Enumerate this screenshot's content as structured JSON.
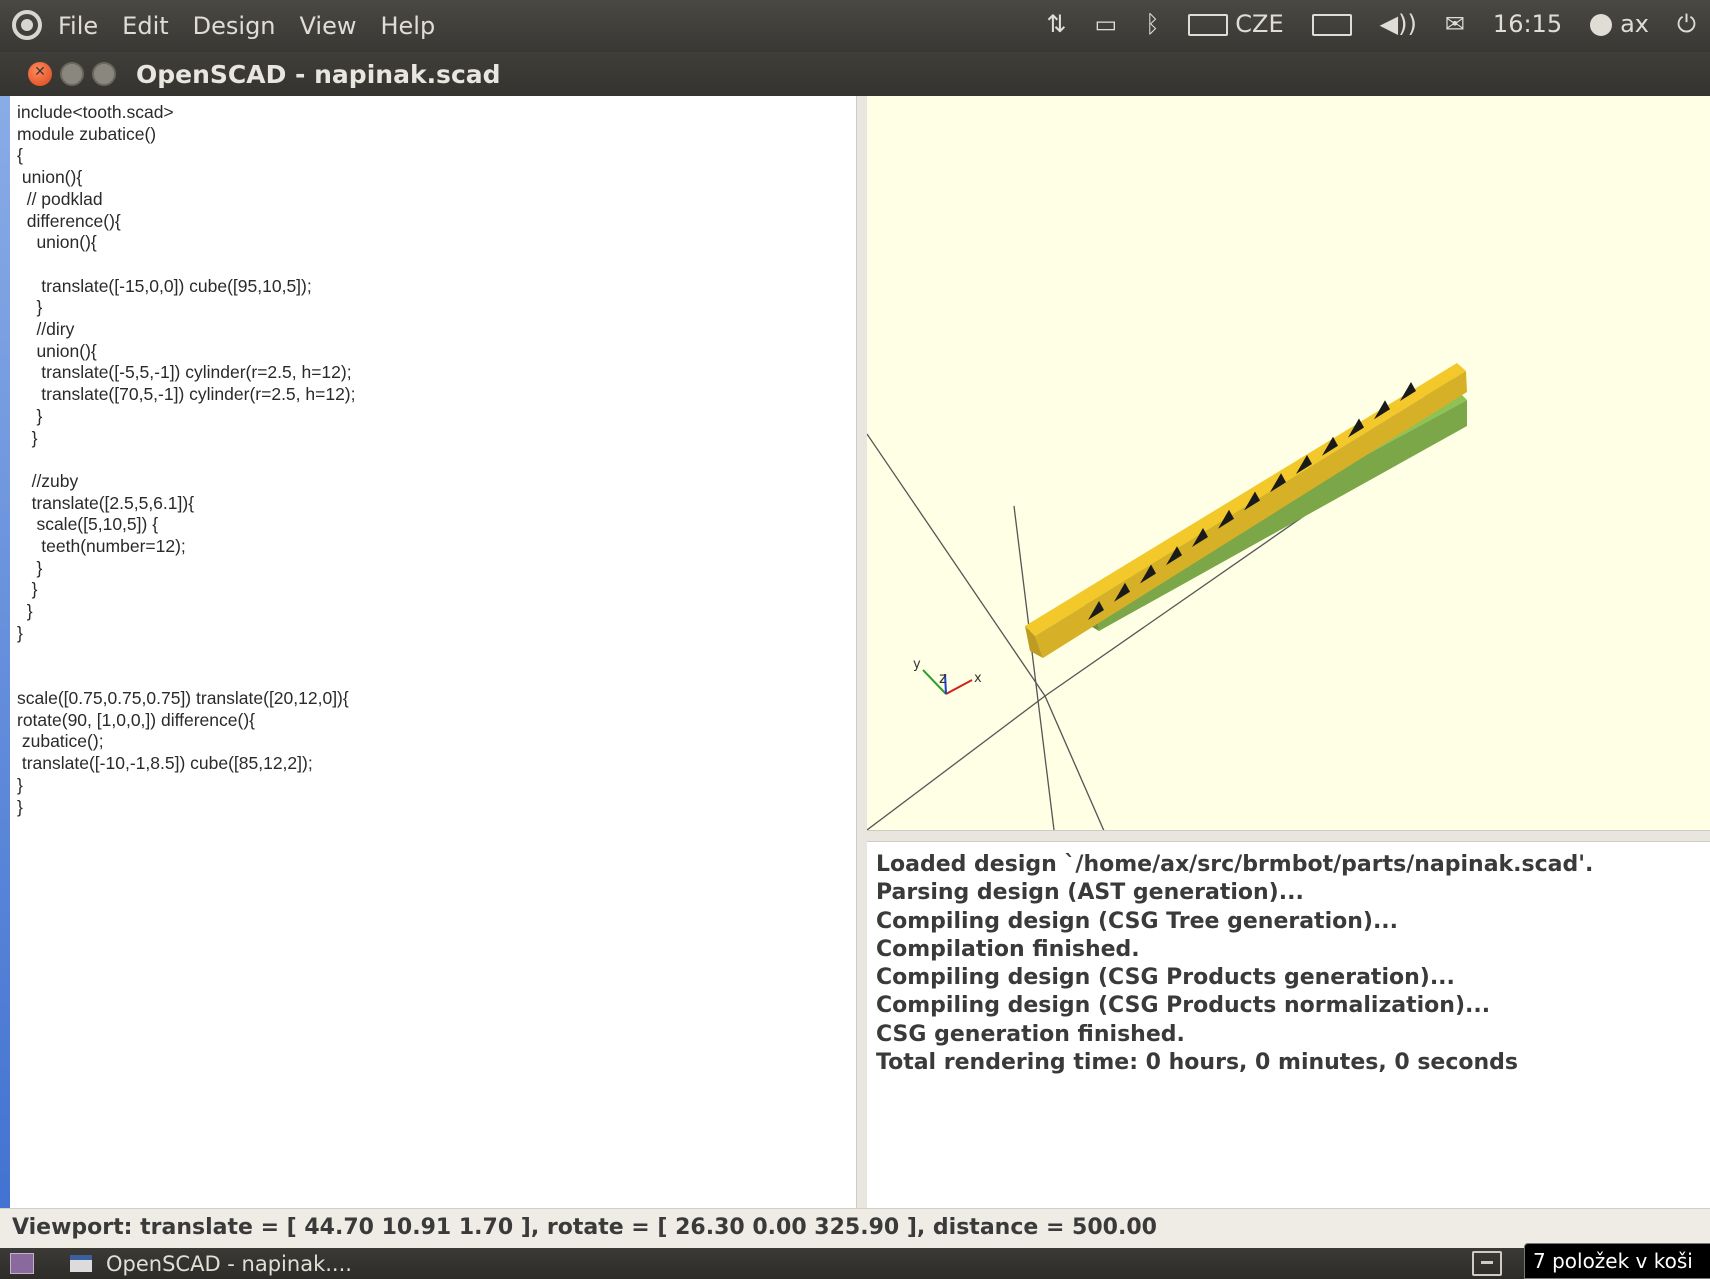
{
  "top_panel": {
    "menu": [
      "File",
      "Edit",
      "Design",
      "View",
      "Help"
    ],
    "indicators": {
      "network_icon": "network-arrows-icon",
      "display_icon": "monitor-icon",
      "bluetooth_icon": "bluetooth-icon",
      "keyboard_label": "CZE",
      "battery_icon": "battery-icon",
      "volume_icon": "speaker-icon",
      "mail_icon": "envelope-icon",
      "time": "16:15",
      "user": "ax",
      "power_icon": "power-icon"
    }
  },
  "window": {
    "title": "OpenSCAD - napinak.scad"
  },
  "editor": {
    "lines": [
      "include<tooth.scad>",
      "module zubatice()",
      "{",
      " union(){",
      "  // podklad",
      "  difference(){",
      "    union(){",
      "",
      "     translate([-15,0,0]) cube([95,10,5]);",
      "    }",
      "    //diry",
      "    union(){",
      "     translate([-5,5,-1]) cylinder(r=2.5, h=12);",
      "     translate([70,5,-1]) cylinder(r=2.5, h=12);",
      "    }",
      "   }",
      "",
      "   //zuby",
      "   translate([2.5,5,6.1]){",
      "    scale([5,10,5]) {",
      "     teeth(number=12);",
      "    }",
      "   }",
      "  }",
      "}",
      "",
      "",
      "scale([0.75,0.75,0.75]) translate([20,12,0]){",
      "rotate(90, [1,0,0,]) difference(){",
      " zubatice();",
      " translate([-10,-1,8.5]) cube([85,12,2]);",
      "}",
      "}"
    ]
  },
  "viewport": {
    "background": "#ffffe5",
    "part_colors": {
      "yellow": "#f3c82b",
      "green": "#8fc255"
    },
    "axes_labels": {
      "x": "x",
      "y": "y",
      "z": "z"
    }
  },
  "console": {
    "lines": [
      "Loaded design `/home/ax/src/brmbot/parts/napinak.scad'.",
      "Parsing design (AST generation)...",
      "Compiling design (CSG Tree generation)...",
      "Compilation finished.",
      "Compiling design (CSG Products generation)...",
      "Compiling design (CSG Products normalization)...",
      "CSG generation finished.",
      "Total rendering time: 0 hours, 0 minutes, 0 seconds"
    ]
  },
  "status": {
    "text": "Viewport: translate = [ 44.70 10.91 1.70 ], rotate = [ 26.30 0.00 325.90 ], distance = 500.00"
  },
  "taskbar": {
    "task_label": "OpenSCAD - napinak....",
    "trash_tooltip": "7 položek v koši"
  }
}
